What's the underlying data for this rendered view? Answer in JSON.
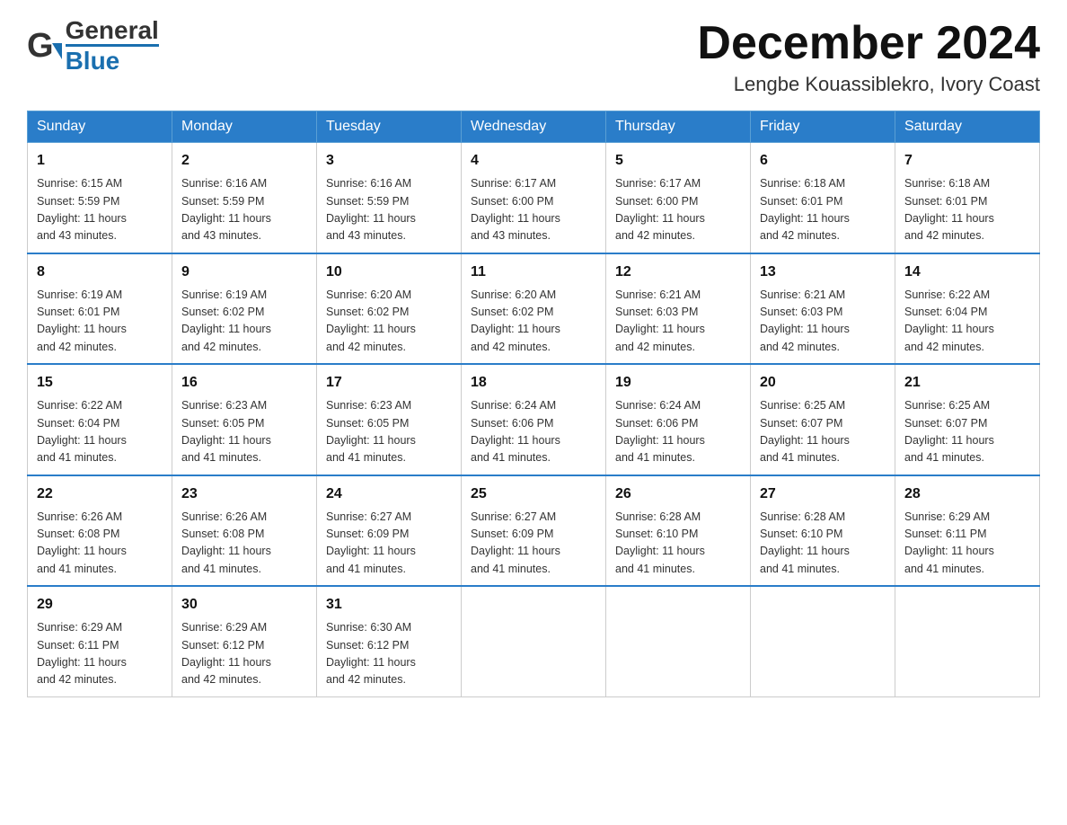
{
  "header": {
    "logo_general": "General",
    "logo_blue": "Blue",
    "month_title": "December 2024",
    "location": "Lengbe Kouassiblekro, Ivory Coast"
  },
  "weekdays": [
    "Sunday",
    "Monday",
    "Tuesday",
    "Wednesday",
    "Thursday",
    "Friday",
    "Saturday"
  ],
  "weeks": [
    [
      {
        "day": "1",
        "sunrise": "6:15 AM",
        "sunset": "5:59 PM",
        "daylight": "11 hours and 43 minutes."
      },
      {
        "day": "2",
        "sunrise": "6:16 AM",
        "sunset": "5:59 PM",
        "daylight": "11 hours and 43 minutes."
      },
      {
        "day": "3",
        "sunrise": "6:16 AM",
        "sunset": "5:59 PM",
        "daylight": "11 hours and 43 minutes."
      },
      {
        "day": "4",
        "sunrise": "6:17 AM",
        "sunset": "6:00 PM",
        "daylight": "11 hours and 43 minutes."
      },
      {
        "day": "5",
        "sunrise": "6:17 AM",
        "sunset": "6:00 PM",
        "daylight": "11 hours and 42 minutes."
      },
      {
        "day": "6",
        "sunrise": "6:18 AM",
        "sunset": "6:01 PM",
        "daylight": "11 hours and 42 minutes."
      },
      {
        "day": "7",
        "sunrise": "6:18 AM",
        "sunset": "6:01 PM",
        "daylight": "11 hours and 42 minutes."
      }
    ],
    [
      {
        "day": "8",
        "sunrise": "6:19 AM",
        "sunset": "6:01 PM",
        "daylight": "11 hours and 42 minutes."
      },
      {
        "day": "9",
        "sunrise": "6:19 AM",
        "sunset": "6:02 PM",
        "daylight": "11 hours and 42 minutes."
      },
      {
        "day": "10",
        "sunrise": "6:20 AM",
        "sunset": "6:02 PM",
        "daylight": "11 hours and 42 minutes."
      },
      {
        "day": "11",
        "sunrise": "6:20 AM",
        "sunset": "6:02 PM",
        "daylight": "11 hours and 42 minutes."
      },
      {
        "day": "12",
        "sunrise": "6:21 AM",
        "sunset": "6:03 PM",
        "daylight": "11 hours and 42 minutes."
      },
      {
        "day": "13",
        "sunrise": "6:21 AM",
        "sunset": "6:03 PM",
        "daylight": "11 hours and 42 minutes."
      },
      {
        "day": "14",
        "sunrise": "6:22 AM",
        "sunset": "6:04 PM",
        "daylight": "11 hours and 42 minutes."
      }
    ],
    [
      {
        "day": "15",
        "sunrise": "6:22 AM",
        "sunset": "6:04 PM",
        "daylight": "11 hours and 41 minutes."
      },
      {
        "day": "16",
        "sunrise": "6:23 AM",
        "sunset": "6:05 PM",
        "daylight": "11 hours and 41 minutes."
      },
      {
        "day": "17",
        "sunrise": "6:23 AM",
        "sunset": "6:05 PM",
        "daylight": "11 hours and 41 minutes."
      },
      {
        "day": "18",
        "sunrise": "6:24 AM",
        "sunset": "6:06 PM",
        "daylight": "11 hours and 41 minutes."
      },
      {
        "day": "19",
        "sunrise": "6:24 AM",
        "sunset": "6:06 PM",
        "daylight": "11 hours and 41 minutes."
      },
      {
        "day": "20",
        "sunrise": "6:25 AM",
        "sunset": "6:07 PM",
        "daylight": "11 hours and 41 minutes."
      },
      {
        "day": "21",
        "sunrise": "6:25 AM",
        "sunset": "6:07 PM",
        "daylight": "11 hours and 41 minutes."
      }
    ],
    [
      {
        "day": "22",
        "sunrise": "6:26 AM",
        "sunset": "6:08 PM",
        "daylight": "11 hours and 41 minutes."
      },
      {
        "day": "23",
        "sunrise": "6:26 AM",
        "sunset": "6:08 PM",
        "daylight": "11 hours and 41 minutes."
      },
      {
        "day": "24",
        "sunrise": "6:27 AM",
        "sunset": "6:09 PM",
        "daylight": "11 hours and 41 minutes."
      },
      {
        "day": "25",
        "sunrise": "6:27 AM",
        "sunset": "6:09 PM",
        "daylight": "11 hours and 41 minutes."
      },
      {
        "day": "26",
        "sunrise": "6:28 AM",
        "sunset": "6:10 PM",
        "daylight": "11 hours and 41 minutes."
      },
      {
        "day": "27",
        "sunrise": "6:28 AM",
        "sunset": "6:10 PM",
        "daylight": "11 hours and 41 minutes."
      },
      {
        "day": "28",
        "sunrise": "6:29 AM",
        "sunset": "6:11 PM",
        "daylight": "11 hours and 41 minutes."
      }
    ],
    [
      {
        "day": "29",
        "sunrise": "6:29 AM",
        "sunset": "6:11 PM",
        "daylight": "11 hours and 42 minutes."
      },
      {
        "day": "30",
        "sunrise": "6:29 AM",
        "sunset": "6:12 PM",
        "daylight": "11 hours and 42 minutes."
      },
      {
        "day": "31",
        "sunrise": "6:30 AM",
        "sunset": "6:12 PM",
        "daylight": "11 hours and 42 minutes."
      },
      null,
      null,
      null,
      null
    ]
  ],
  "labels": {
    "sunrise": "Sunrise: ",
    "sunset": "Sunset: ",
    "daylight": "Daylight: "
  }
}
